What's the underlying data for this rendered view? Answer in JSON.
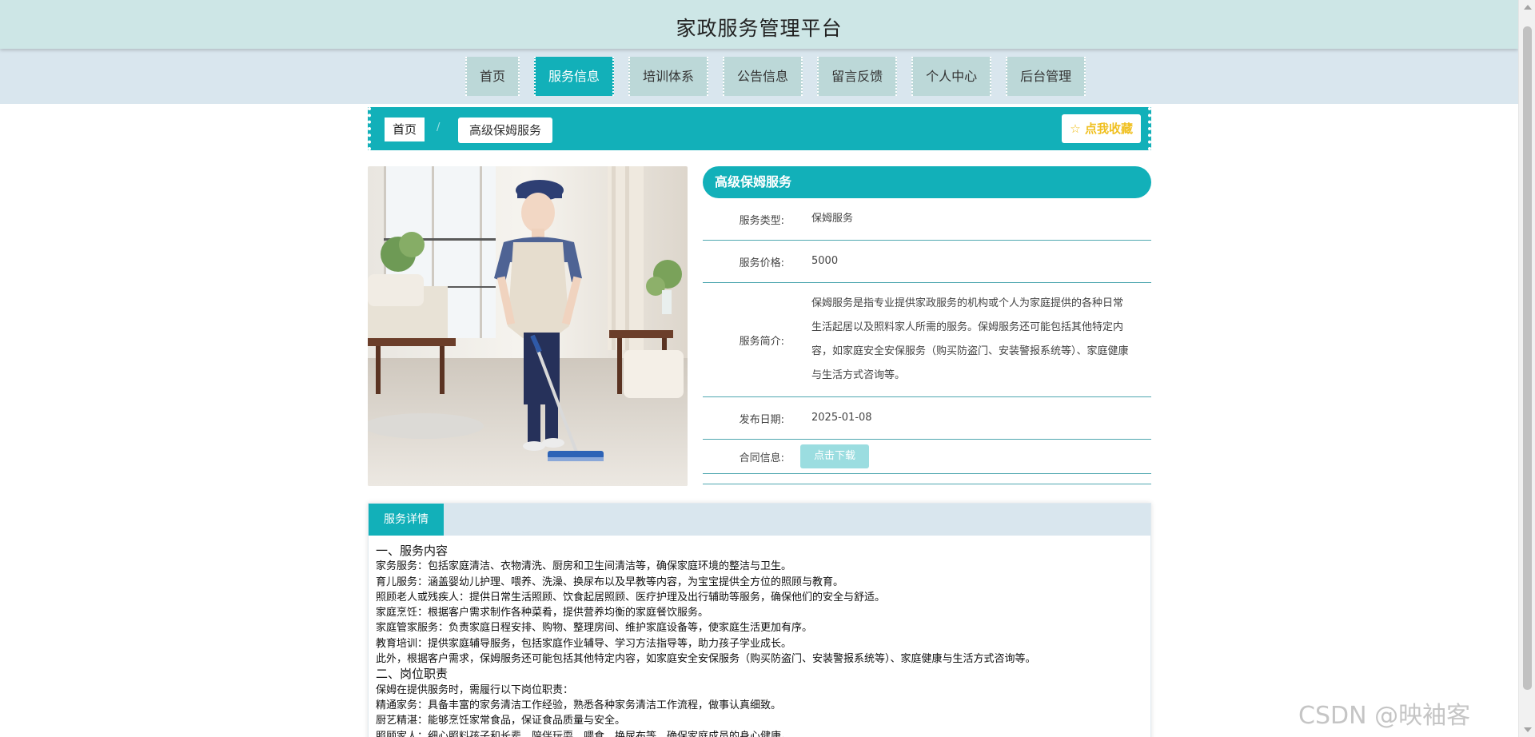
{
  "header": {
    "title": "家政服务管理平台"
  },
  "nav": {
    "items": [
      {
        "label": "首页",
        "active": false
      },
      {
        "label": "服务信息",
        "active": true
      },
      {
        "label": "培训体系",
        "active": false
      },
      {
        "label": "公告信息",
        "active": false
      },
      {
        "label": "留言反馈",
        "active": false
      },
      {
        "label": "个人中心",
        "active": false
      },
      {
        "label": "后台管理",
        "active": false
      }
    ]
  },
  "breadcrumb": {
    "home": "首页",
    "separator": "/",
    "current": "高级保姆服务"
  },
  "favorite": {
    "icon": "star-outline-icon",
    "label": "点我收藏"
  },
  "detail": {
    "title": "高级保姆服务",
    "type_label": "服务类型:",
    "type_value": "保姆服务",
    "price_label": "服务价格:",
    "price_value": "5000",
    "intro_label": "服务简介:",
    "intro_value": "保姆服务是指专业提供家政服务的机构或个人为家庭提供的各种日常生活起居以及照料家人所需的服务。保姆服务还可能包括其他特定内容，如家庭安全安保服务（购买防盗门、安装警报系统等）、家庭健康与生活方式咨询等。",
    "date_label": "发布日期:",
    "date_value": "2025-01-08",
    "contract_label": "合同信息:",
    "download_label": "点击下载"
  },
  "tabs": {
    "active_label": "服务详情",
    "content": [
      {
        "text": "一、服务内容",
        "section": true
      },
      {
        "text": "家务服务：包括家庭清洁、衣物清洗、厨房和卫生间清洁等，确保家庭环境的整洁与卫生。"
      },
      {
        "text": "育儿服务：涵盖婴幼儿护理、喂养、洗澡、换尿布以及早教等内容，为宝宝提供全方位的照顾与教育。"
      },
      {
        "text": "照顾老人或残疾人：提供日常生活照顾、饮食起居照顾、医疗护理及出行辅助等服务，确保他们的安全与舒适。"
      },
      {
        "text": "家庭烹饪：根据客户需求制作各种菜肴，提供营养均衡的家庭餐饮服务。"
      },
      {
        "text": "家庭管家服务：负责家庭日程安排、购物、整理房间、维护家庭设备等，使家庭生活更加有序。"
      },
      {
        "text": "教育培训：提供家庭辅导服务，包括家庭作业辅导、学习方法指导等，助力孩子学业成长。"
      },
      {
        "text": "此外，根据客户需求，保姆服务还可能包括其他特定内容，如家庭安全安保服务（购买防盗门、安装警报系统等）、家庭健康与生活方式咨询等。"
      },
      {
        "text": "二、岗位职责",
        "section": true
      },
      {
        "text": "保姆在提供服务时，需履行以下岗位职责："
      },
      {
        "text": "精通家务：具备丰富的家务清洁工作经验，熟悉各种家务清洁工作流程，做事认真细致。"
      },
      {
        "text": "厨艺精湛：能够烹饪家常食品，保证食品质量与安全。"
      },
      {
        "text": "照顾家人：细心照料孩子和长辈，陪伴玩耍、喂食、换尿布等，确保家庭成员的身心健康。"
      }
    ]
  },
  "watermark": "CSDN @映袖客"
}
